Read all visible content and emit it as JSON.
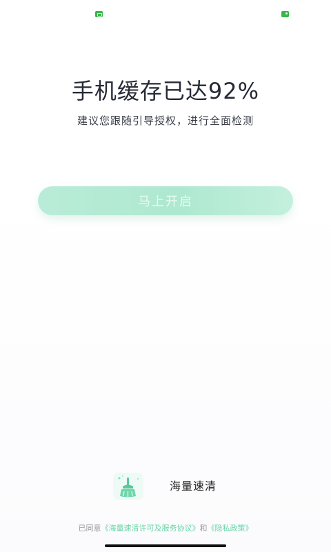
{
  "status_bar": {
    "left_icon": "square-status-icon",
    "right_icon": "battery-status-icon",
    "accent": "#39b54a"
  },
  "main": {
    "headline": "手机缓存已达92%",
    "subline": "建议您跟随引导授权，进行全面检测",
    "start_button_label": "马上开启"
  },
  "brand": {
    "icon": "broom-clean-icon",
    "name": "海量速清"
  },
  "agreement": {
    "prefix": "已同意",
    "license_link": "《海量速清许可及服务协议》",
    "conjunction": "和",
    "privacy_link": "《隐私政策》"
  },
  "colors": {
    "button_gradient_start": "#b9ecd8",
    "button_gradient_end": "#c3f0dd",
    "link_green": "#69d4a7",
    "headline_text": "#262a36"
  }
}
